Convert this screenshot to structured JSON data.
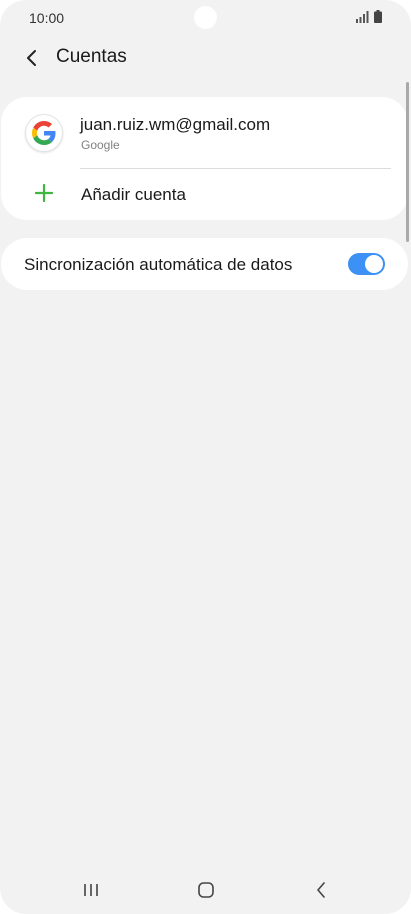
{
  "status_bar": {
    "time": "10:00"
  },
  "header": {
    "title": "Cuentas"
  },
  "accounts": [
    {
      "email": "juan.ruiz.wm@gmail.com",
      "type": "Google"
    }
  ],
  "add_account": {
    "label": "Añadir cuenta"
  },
  "sync": {
    "label": "Sincronización automática de datos",
    "enabled": true
  },
  "colors": {
    "accent": "#3e91f4",
    "add_icon": "#3fb73f",
    "background": "#f2f2f2"
  },
  "icons": {
    "back": "back-arrow-icon",
    "account": "google-icon",
    "add": "plus-icon",
    "nav": [
      "recent-apps-icon",
      "home-icon",
      "back-icon"
    ]
  }
}
